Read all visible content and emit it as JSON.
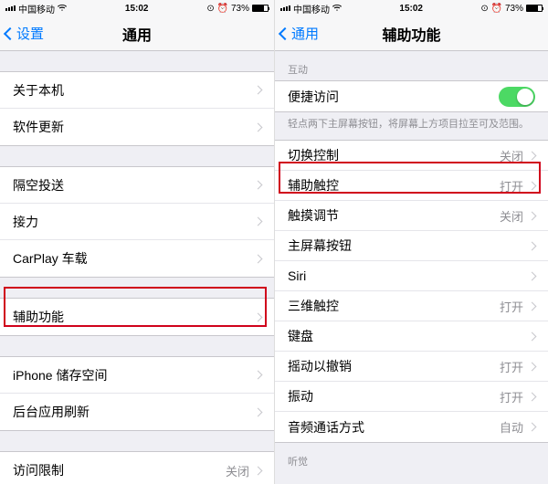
{
  "status": {
    "carrier": "中国移动",
    "time": "15:02",
    "battery_pct": "73%",
    "alarm_icon": "⏰"
  },
  "left": {
    "back_label": "设置",
    "title": "通用",
    "g1": [
      {
        "label": "关于本机"
      },
      {
        "label": "软件更新"
      }
    ],
    "g2": [
      {
        "label": "隔空投送"
      },
      {
        "label": "接力"
      },
      {
        "label": "CarPlay 车载"
      }
    ],
    "g3": [
      {
        "label": "辅助功能"
      }
    ],
    "g4": [
      {
        "label": "iPhone 储存空间"
      },
      {
        "label": "后台应用刷新"
      }
    ],
    "g5": [
      {
        "label": "访问限制",
        "value": "关闭"
      }
    ]
  },
  "right": {
    "back_label": "通用",
    "title": "辅助功能",
    "section1_header": "互动",
    "reachability_label": "便捷访问",
    "reachability_note": "轻点两下主屏幕按钮，将屏幕上方项目拉至可及范围。",
    "rows": [
      {
        "label": "切换控制",
        "value": "关闭"
      },
      {
        "label": "辅助触控",
        "value": "打开"
      },
      {
        "label": "触摸调节",
        "value": "关闭"
      },
      {
        "label": "主屏幕按钮",
        "value": ""
      },
      {
        "label": "Siri",
        "value": ""
      },
      {
        "label": "三维触控",
        "value": "打开"
      },
      {
        "label": "键盘",
        "value": ""
      },
      {
        "label": "摇动以撤销",
        "value": "打开"
      },
      {
        "label": "振动",
        "value": "打开"
      },
      {
        "label": "音频通话方式",
        "value": "自动"
      }
    ],
    "section2_header": "听觉"
  }
}
